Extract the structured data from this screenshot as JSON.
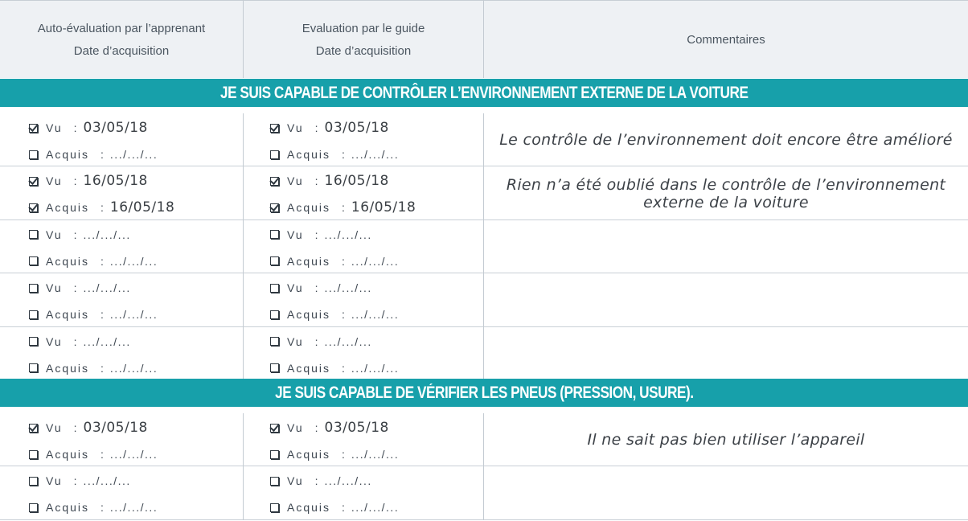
{
  "header": {
    "col1_line1": "Auto-évaluation par l’apprenant",
    "col1_line2": "Date d’acquisition",
    "col2_line1": "Evaluation par le guide",
    "col2_line2": "Date d’acquisition",
    "col3": "Commentaires"
  },
  "sections": [
    {
      "title": "JE SUIS CAPABLE DE CONTRÔLER L’ENVIRONNEMENT EXTERNE DE LA VOITURE",
      "rows": [
        {
          "learner": {
            "vu_checked": true,
            "vu_date": "03/05/18",
            "acquis_checked": false,
            "acquis_date": ".../.../..."
          },
          "guide": {
            "vu_checked": true,
            "vu_date": "03/05/18",
            "acquis_checked": false,
            "acquis_date": ".../.../..."
          },
          "comment_line1": "Le contrôle de l’environnement doit encore être amélioré",
          "comment_line2": ""
        },
        {
          "learner": {
            "vu_checked": true,
            "vu_date": "16/05/18",
            "acquis_checked": true,
            "acquis_date": "16/05/18"
          },
          "guide": {
            "vu_checked": true,
            "vu_date": "16/05/18",
            "acquis_checked": true,
            "acquis_date": "16/05/18"
          },
          "comment_line1": "Rien n’a été oublié dans le contrôle de l’environnement",
          "comment_line2": "externe de la voiture"
        },
        {
          "learner": {
            "vu_checked": false,
            "vu_date": ".../.../...",
            "acquis_checked": false,
            "acquis_date": ".../.../..."
          },
          "guide": {
            "vu_checked": false,
            "vu_date": ".../.../...",
            "acquis_checked": false,
            "acquis_date": ".../.../..."
          },
          "comment_line1": "",
          "comment_line2": ""
        },
        {
          "learner": {
            "vu_checked": false,
            "vu_date": ".../.../...",
            "acquis_checked": false,
            "acquis_date": ".../.../..."
          },
          "guide": {
            "vu_checked": false,
            "vu_date": ".../.../...",
            "acquis_checked": false,
            "acquis_date": ".../.../..."
          },
          "comment_line1": "",
          "comment_line2": ""
        },
        {
          "learner": {
            "vu_checked": false,
            "vu_date": ".../.../...",
            "acquis_checked": false,
            "acquis_date": ".../.../..."
          },
          "guide": {
            "vu_checked": false,
            "vu_date": ".../.../...",
            "acquis_checked": false,
            "acquis_date": ".../.../..."
          },
          "comment_line1": "",
          "comment_line2": ""
        }
      ]
    },
    {
      "title": "JE SUIS CAPABLE DE VÉRIFIER LES PNEUS (PRESSION, USURE).",
      "rows": [
        {
          "learner": {
            "vu_checked": true,
            "vu_date": "03/05/18",
            "acquis_checked": false,
            "acquis_date": ".../.../..."
          },
          "guide": {
            "vu_checked": true,
            "vu_date": "03/05/18",
            "acquis_checked": false,
            "acquis_date": ".../.../..."
          },
          "comment_line1": "Il ne sait pas bien utiliser l’appareil",
          "comment_line2": ""
        },
        {
          "learner": {
            "vu_checked": false,
            "vu_date": ".../.../...",
            "acquis_checked": false,
            "acquis_date": ".../.../..."
          },
          "guide": {
            "vu_checked": false,
            "vu_date": ".../.../...",
            "acquis_checked": false,
            "acquis_date": ".../.../..."
          },
          "comment_line1": "",
          "comment_line2": ""
        }
      ]
    }
  ],
  "labels": {
    "vu": "Vu",
    "acquis": "Acquis",
    "separator": ":"
  },
  "colors": {
    "band": "#17a0aa",
    "header_bg": "#eef1f4",
    "grid": "#c4cbd2"
  }
}
